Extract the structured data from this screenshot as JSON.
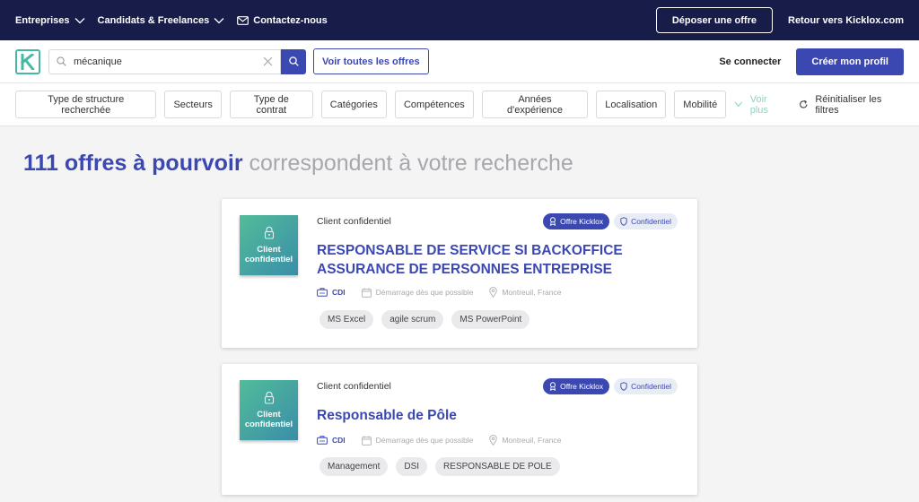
{
  "topbar": {
    "nav": [
      {
        "label": "Entreprises",
        "icon": "chevron-down-icon"
      },
      {
        "label": "Candidats & Freelances",
        "icon": "chevron-down-icon"
      },
      {
        "label": "Contactez-nous",
        "icon": "mail-icon"
      }
    ],
    "post_offer": "Déposer une offre",
    "back_link": "Retour vers Kicklox.com"
  },
  "search": {
    "logo_letter": "K",
    "value": "mécanique",
    "see_all": "Voir toutes les offres",
    "login": "Se connecter",
    "create_profile": "Créer mon profil"
  },
  "filters": {
    "chips": [
      "Type de structure recherchée",
      "Secteurs",
      "Type de contrat",
      "Catégories",
      "Compétences",
      "Années d'expérience",
      "Localisation",
      "Mobilité"
    ],
    "see_more": "Voir plus",
    "reset": "Réinitialiser les filtres"
  },
  "results": {
    "count": "111 offres à pourvoir",
    "rest": "correspondent à votre recherche"
  },
  "offers": [
    {
      "logo_text": [
        "Client",
        "confidentiel"
      ],
      "company": "Client confidentiel",
      "badges": [
        "Offre Kicklox",
        "Confidentiel"
      ],
      "title": [
        "RESPONSABLE DE SERVICE SI BACKOFFICE",
        "ASSURANCE DE PERSONNES ENTREPRISE"
      ],
      "contract": "CDI",
      "start": "Démarrage dès que possible",
      "location": "Montreuil, France",
      "tags": [
        "MS Excel",
        "agile scrum",
        "MS PowerPoint"
      ]
    },
    {
      "logo_text": [
        "Client",
        "confidentiel"
      ],
      "company": "Client confidentiel",
      "badges": [
        "Offre Kicklox",
        "Confidentiel"
      ],
      "title": [
        "Responsable de Pôle",
        ""
      ],
      "contract": "CDI",
      "start": "Démarrage dès que possible",
      "location": "Montreuil, France",
      "tags": [
        "Management",
        "DSI",
        "RESPONSABLE DE POLE"
      ]
    }
  ],
  "colors": {
    "navy": "#181c48",
    "primary": "#3c48b1",
    "accent": "#47b8a3"
  }
}
